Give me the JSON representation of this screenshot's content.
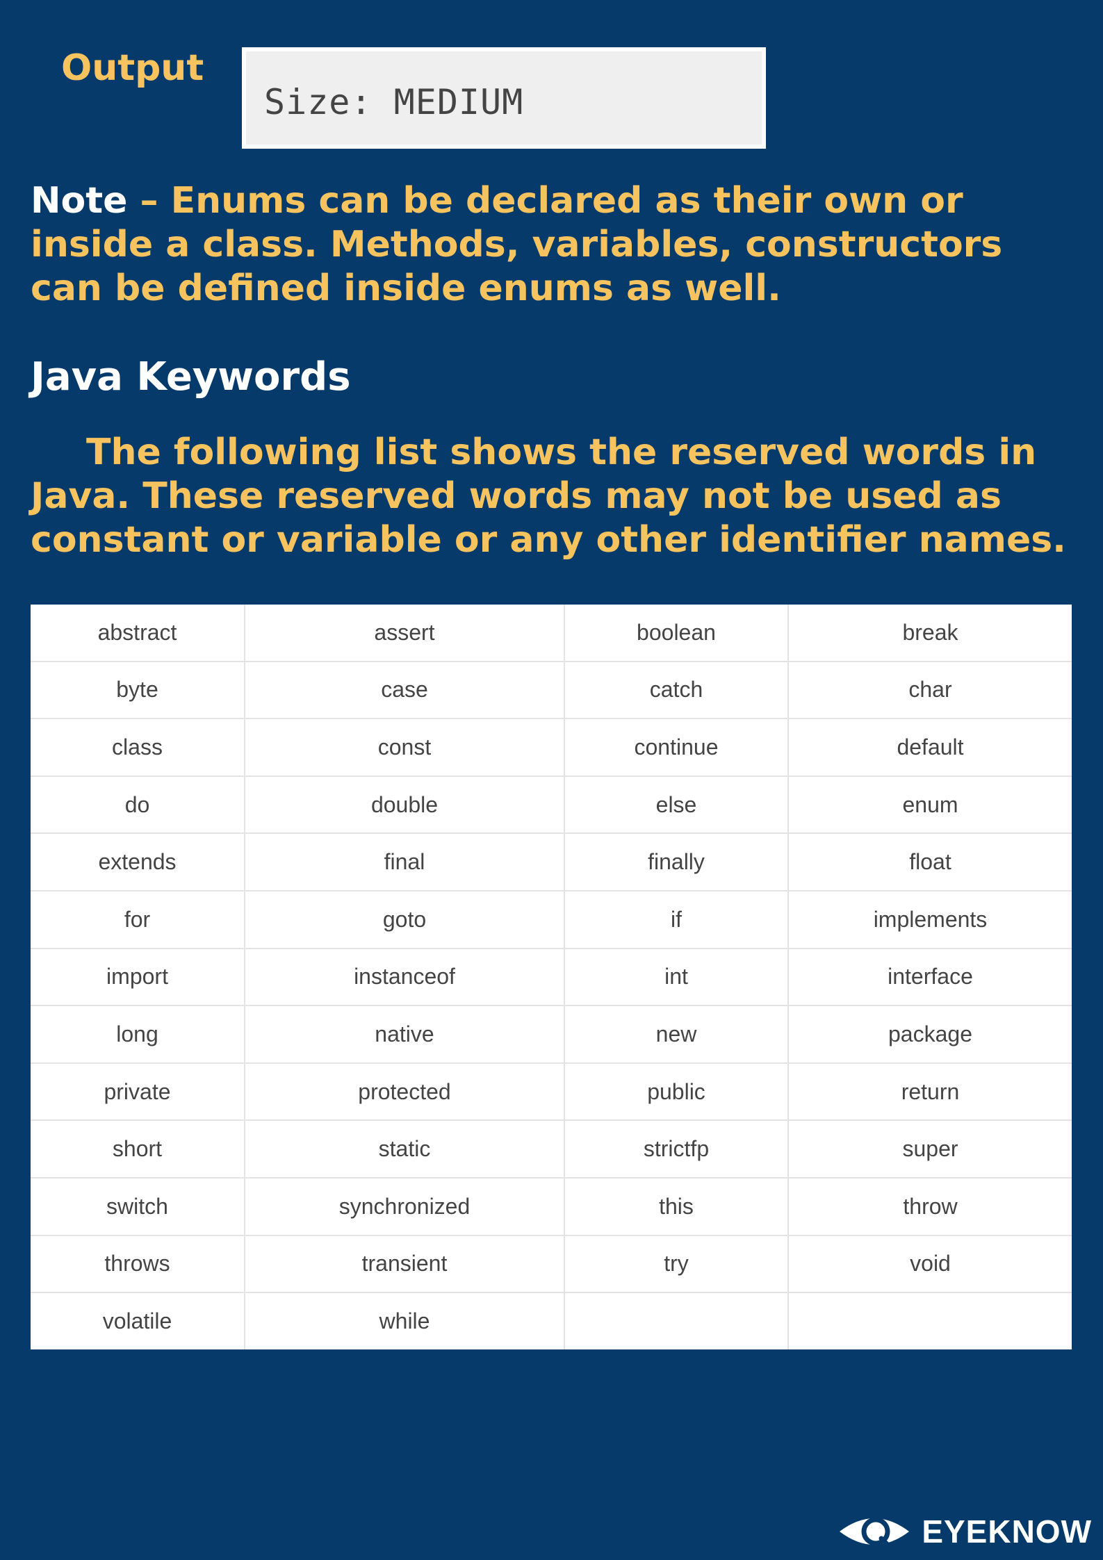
{
  "output": {
    "label": "Output",
    "text": "Size: MEDIUM"
  },
  "note": {
    "label": "Note",
    "dash": " – ",
    "text": "Enums can be declared as their own or inside a class. Methods, variables, constructors can be defined inside enums as well."
  },
  "heading": "Java Keywords",
  "paragraph": "The following list shows the reserved words in Java. These reserved words may not be used as constant or variable or any other identifier names.",
  "keywords": [
    [
      "abstract",
      "assert",
      "boolean",
      "break"
    ],
    [
      "byte",
      "case",
      "catch",
      "char"
    ],
    [
      "class",
      "const",
      "continue",
      "default"
    ],
    [
      "do",
      "double",
      "else",
      "enum"
    ],
    [
      "extends",
      "final",
      "finally",
      "float"
    ],
    [
      "for",
      "goto",
      "if",
      "implements"
    ],
    [
      "import",
      "instanceof",
      "int",
      "interface"
    ],
    [
      "long",
      "native",
      "new",
      "package"
    ],
    [
      "private",
      "protected",
      "public",
      "return"
    ],
    [
      "short",
      "static",
      "strictfp",
      "super"
    ],
    [
      "switch",
      "synchronized",
      "this",
      "throw"
    ],
    [
      "throws",
      "transient",
      "try",
      "void"
    ],
    [
      "volatile",
      "while",
      "",
      ""
    ]
  ],
  "brand": {
    "name": "EYEKNOW",
    "icon": "eye-logo-icon"
  },
  "colors": {
    "background": "#063a6a",
    "accent": "#f7c35f",
    "heading": "#ffffff"
  }
}
